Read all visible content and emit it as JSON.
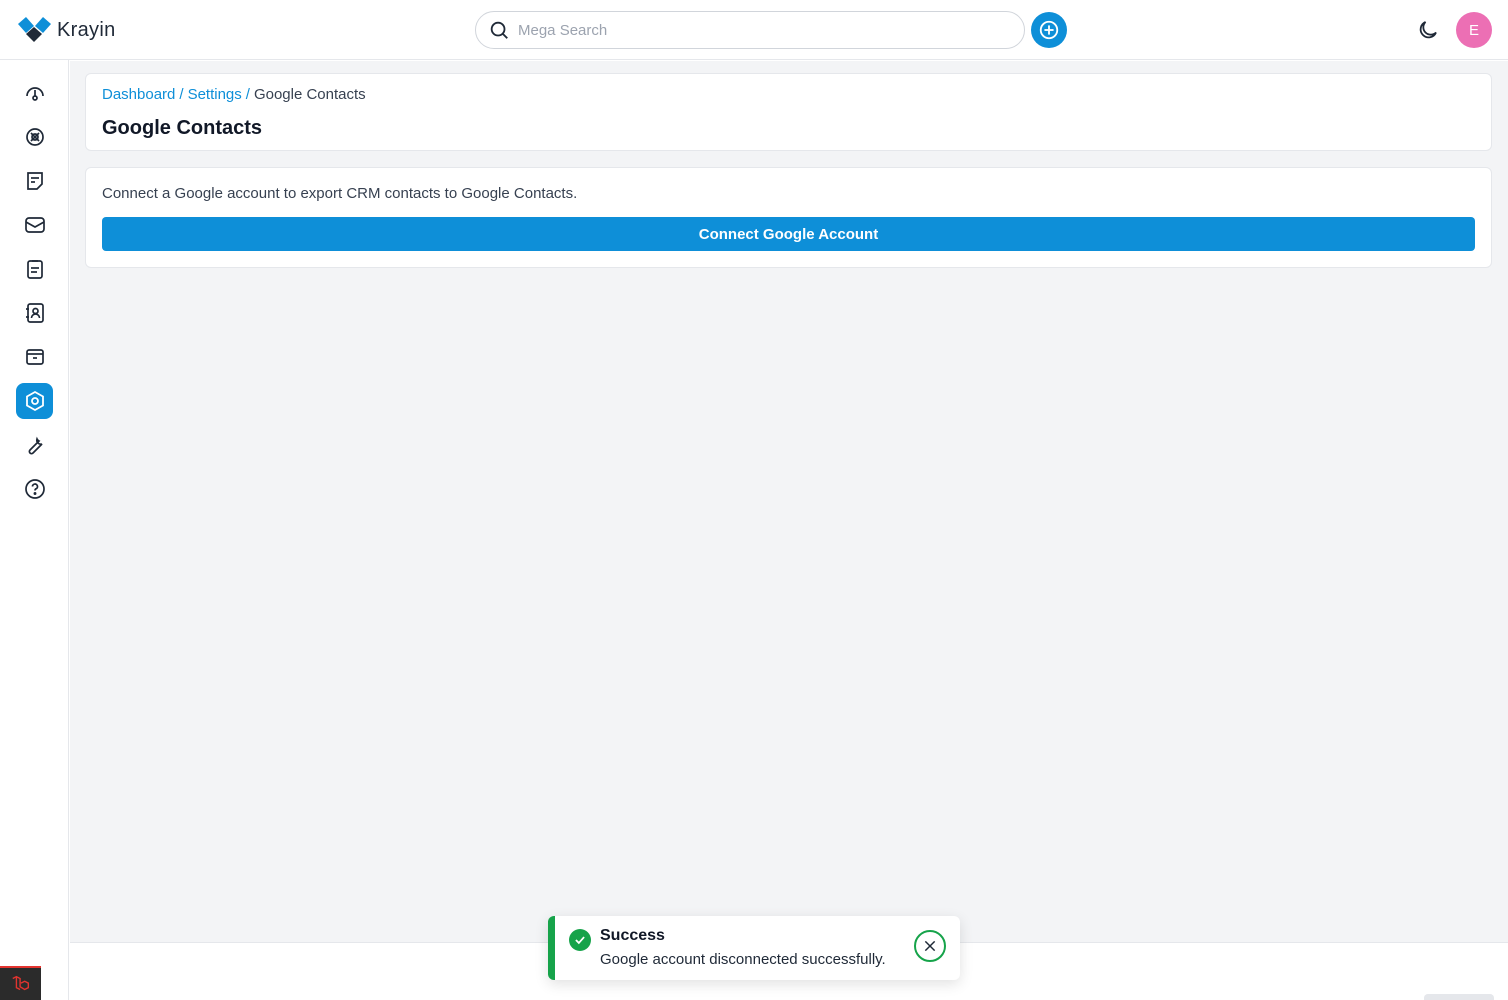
{
  "app": {
    "name": "Krayin"
  },
  "search": {
    "placeholder": "Mega Search"
  },
  "header": {
    "avatar_initial": "E"
  },
  "sidebar": {
    "items": [
      {
        "name": "dashboard",
        "icon": "dashboard-gauge-icon",
        "active": false
      },
      {
        "name": "leads",
        "icon": "leads-icon",
        "active": false
      },
      {
        "name": "quotes",
        "icon": "quotes-icon",
        "active": false
      },
      {
        "name": "mail",
        "icon": "mail-icon",
        "active": false
      },
      {
        "name": "activities",
        "icon": "activities-icon",
        "active": false
      },
      {
        "name": "contacts",
        "icon": "contacts-icon",
        "active": false
      },
      {
        "name": "products",
        "icon": "products-icon",
        "active": false
      },
      {
        "name": "settings",
        "icon": "settings-icon",
        "active": true
      },
      {
        "name": "configuration",
        "icon": "wrench-icon",
        "active": false
      },
      {
        "name": "help",
        "icon": "help-icon",
        "active": false
      }
    ]
  },
  "breadcrumb": {
    "items": [
      "Dashboard",
      "Settings",
      "Google Contacts"
    ],
    "separator": "/"
  },
  "page": {
    "title": "Google Contacts",
    "description": "Connect a Google account to export CRM contacts to Google Contacts.",
    "connect_button": "Connect Google Account"
  },
  "toast": {
    "title": "Success",
    "message": "Google account disconnected successfully."
  },
  "colors": {
    "accent": "#0e8fd8",
    "success": "#16a34a",
    "avatar": "#ec6fb4",
    "background": "#f3f4f6"
  }
}
